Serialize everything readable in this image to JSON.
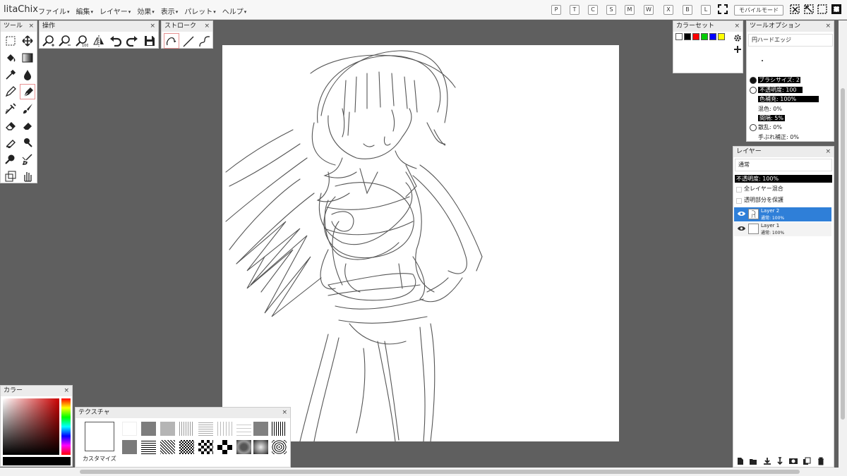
{
  "app": {
    "title": "litaChix"
  },
  "menubar": {
    "menus": [
      "ファイル",
      "編集",
      "レイヤー",
      "効果",
      "表示",
      "パレット",
      "ヘルプ"
    ],
    "shortcut_buttons": [
      "P",
      "T",
      "C",
      "S",
      "M",
      "W",
      "X",
      "B",
      "L"
    ],
    "mobile_mode_label": "モバイルモード"
  },
  "tools_panel": {
    "title": "ツール",
    "close": "×"
  },
  "operations_panel": {
    "title": "操作",
    "close": "×"
  },
  "stroke_panel": {
    "title": "ストローク",
    "close": "×"
  },
  "colorset_panel": {
    "title": "カラーセット",
    "close": "×",
    "swatches": [
      "#ffffff",
      "#000000",
      "#ff0000",
      "#00cc00",
      "#0000ff",
      "#ffff00"
    ]
  },
  "tool_options": {
    "title": "ツールオプション",
    "close": "×",
    "brush_name": "円ハードエッジ",
    "brush_size": "ブラシサイズ: 2",
    "opacity": "不透明度: 100",
    "fill": "色補充: 100%",
    "blend": "混色: 0%",
    "spacing": "間隔: 5%",
    "scatter": "散乱: 0%",
    "stabilizer": "手ぶれ補正: 0%"
  },
  "layers_panel": {
    "title": "レイヤー",
    "close": "×",
    "blend_mode": "通常",
    "opacity": "不透明度: 100%",
    "merge_all": "全レイヤー混合",
    "protect_alpha": "透明部分を保護",
    "layers": [
      {
        "name": "Layer 2",
        "mode": "通常: 100%",
        "selected": true
      },
      {
        "name": "Layer 1",
        "mode": "通常: 100%",
        "selected": false
      }
    ]
  },
  "color_panel": {
    "title": "カラー",
    "close": "×",
    "hue_color": "#cc0000",
    "current_color": "#000000"
  },
  "texture_panel": {
    "title": "テクスチャ",
    "close": "×",
    "customize": "カスタマイズ"
  }
}
